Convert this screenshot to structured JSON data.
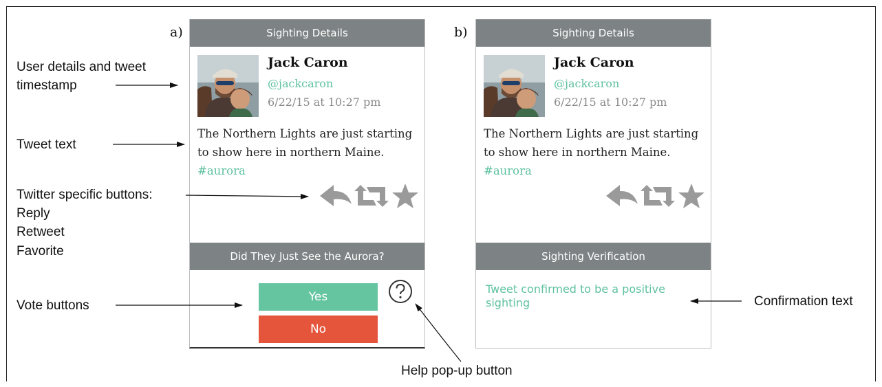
{
  "panel_a": {
    "label": "a)",
    "header_title": "Sighting Details",
    "user_name": "Jack Caron",
    "user_handle": "@jackcaron",
    "timestamp": "6/22/15 at 10:27 pm",
    "tweet_text": "The Northern Lights are just starting to show here in northern Maine. ",
    "hashtag": "#aurora",
    "section_title": "Did They Just See the Aurora?",
    "yes_label": "Yes",
    "no_label": "No",
    "icons": [
      "avatar-photo",
      "reply-icon",
      "retweet-icon",
      "favorite-star-icon",
      "help-question-icon"
    ]
  },
  "panel_b": {
    "label": "b)",
    "header_title": "Sighting Details",
    "user_name": "Jack Caron",
    "user_handle": "@jackcaron",
    "timestamp": "6/22/15 at 10:27 pm",
    "tweet_text": "The Northern Lights are just starting to show here in northern Maine. ",
    "hashtag": "#aurora",
    "section_title": "Sighting Verification",
    "confirmation": "Tweet confirmed to be a positive sighting"
  },
  "annotations": {
    "user_details": "User details and tweet timestamp",
    "tweet_text": "Tweet text",
    "twitter_buttons": "Twitter specific buttons:",
    "reply": "Reply",
    "retweet": "Retweet",
    "favorite": "Favorite",
    "vote_buttons": "Vote buttons",
    "help_button": "Help pop-up button",
    "confirmation_text": "Confirmation text"
  },
  "colors": {
    "header_bg": "#7d8385",
    "accent_green": "#5ec1a0",
    "yes_green": "#65c5a1",
    "no_red": "#e5553c",
    "icon_gray": "#9a9a9a"
  }
}
